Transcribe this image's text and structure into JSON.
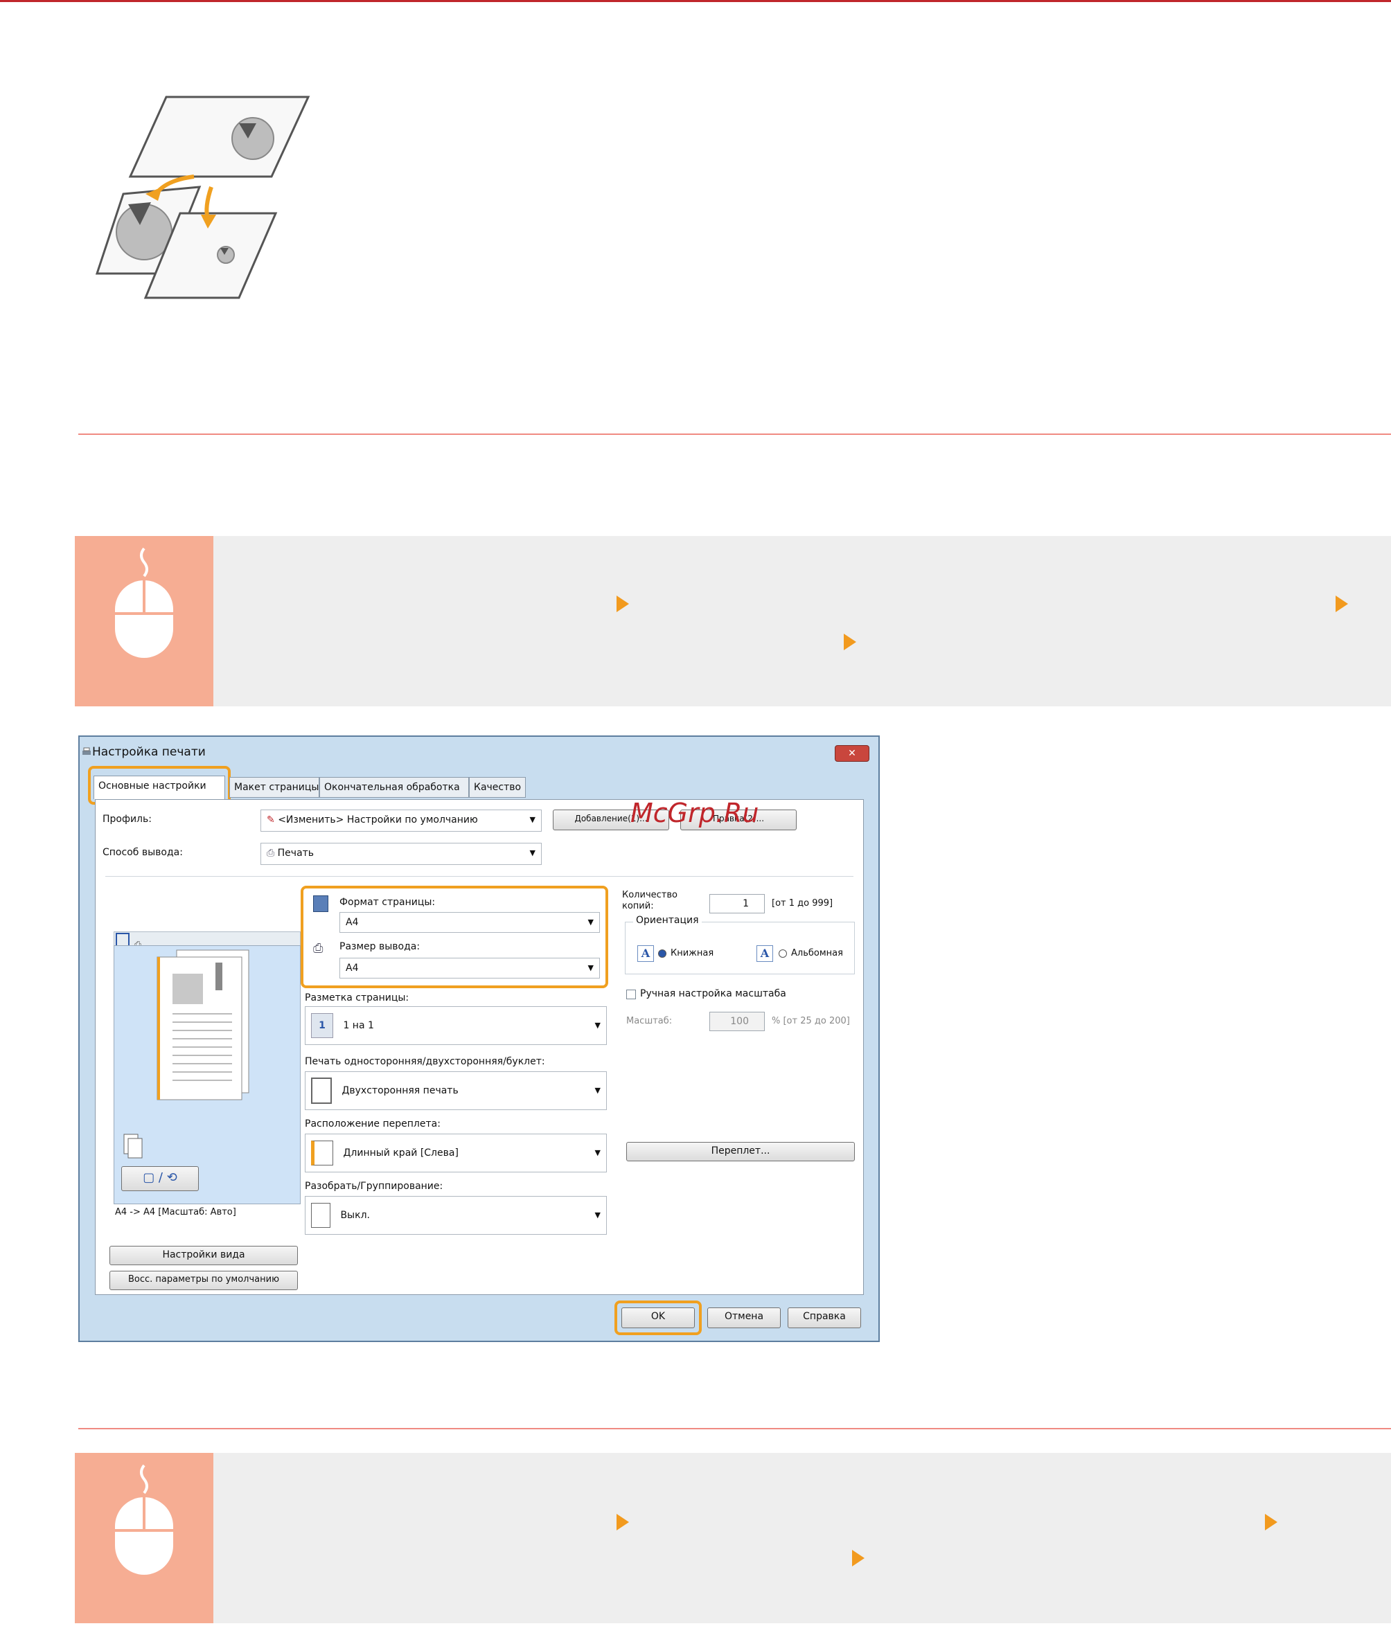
{
  "watermark": "McGrp.Ru",
  "dialog": {
    "title": "Настройка печати",
    "close_label": "✕",
    "tabs": [
      "Основные настройки",
      "Макет страницы",
      "Окончательная обработка",
      "Качество"
    ],
    "profile_label": "Профиль:",
    "profile_value": "<Изменить> Настройки по умолчанию",
    "add_button": "Добавление(1)...",
    "edit_button": "Правка(2)...",
    "output_method_label": "Способ вывода:",
    "output_method_value": "Печать",
    "page_size_label": "Формат страницы:",
    "page_size_value": "A4",
    "output_size_label": "Размер вывода:",
    "output_size_value": "A4",
    "copies_label": "Количество копий:",
    "copies_value": "1",
    "copies_range": "[от 1 до 999]",
    "orientation_label": "Ориентация",
    "portrait_label": "Книжная",
    "landscape_label": "Альбомная",
    "page_layout_label": "Разметка страницы:",
    "page_layout_value": "1 на 1",
    "manual_scale_label": "Ручная настройка масштаба",
    "scale_label": "Масштаб:",
    "scale_value": "100",
    "scale_range": "% [от 25 до 200]",
    "duplex_label": "Печать односторонняя/двухсторонняя/буклет:",
    "duplex_value": "Двухсторонняя печать",
    "binding_location_label": "Расположение переплета:",
    "binding_location_value": "Длинный край [Слева]",
    "binding_button": "Переплет...",
    "collate_label": "Разобрать/Группирование:",
    "collate_value": "Выкл.",
    "preview_caption": "A4 -> A4 [Масштаб: Авто]",
    "view_settings_button": "Настройки вида",
    "restore_defaults_button": "Восс. параметры по умолчанию",
    "ok_button": "OK",
    "cancel_button": "Отмена",
    "help_button": "Справка"
  },
  "colors": {
    "accent_orange": "#f0a020",
    "rule_red": "#c0262b",
    "step_panel": "#f6ad93"
  }
}
